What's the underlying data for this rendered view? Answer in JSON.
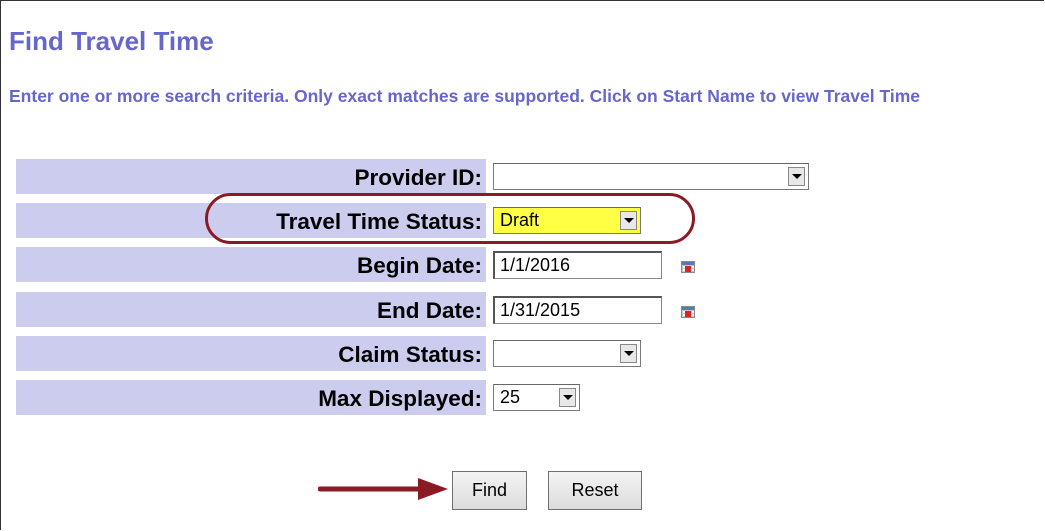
{
  "page": {
    "title": "Find Travel Time",
    "instructions": "Enter one or more search criteria. Only exact matches are supported. Click on Start Name to view Travel Time"
  },
  "form": {
    "provider_id": {
      "label": "Provider ID:",
      "value": ""
    },
    "travel_time_status": {
      "label": "Travel Time Status:",
      "value": "Draft"
    },
    "begin_date": {
      "label": "Begin Date:",
      "value": "1/1/2016"
    },
    "end_date": {
      "label": "End Date:",
      "value": "1/31/2015"
    },
    "claim_status": {
      "label": "Claim Status:",
      "value": ""
    },
    "max_displayed": {
      "label": "Max Displayed:",
      "value": "25"
    }
  },
  "buttons": {
    "find_label": "Find",
    "reset_label": "Reset"
  },
  "colors": {
    "heading": "#6666cc",
    "label_background": "#ccccee",
    "highlighted_field": "#ffff44",
    "annotation": "#8b1a24"
  },
  "icons": {
    "date_picker": "calendar-icon",
    "dropdown": "chevron-down-icon",
    "annotation": "arrow-right-icon"
  }
}
